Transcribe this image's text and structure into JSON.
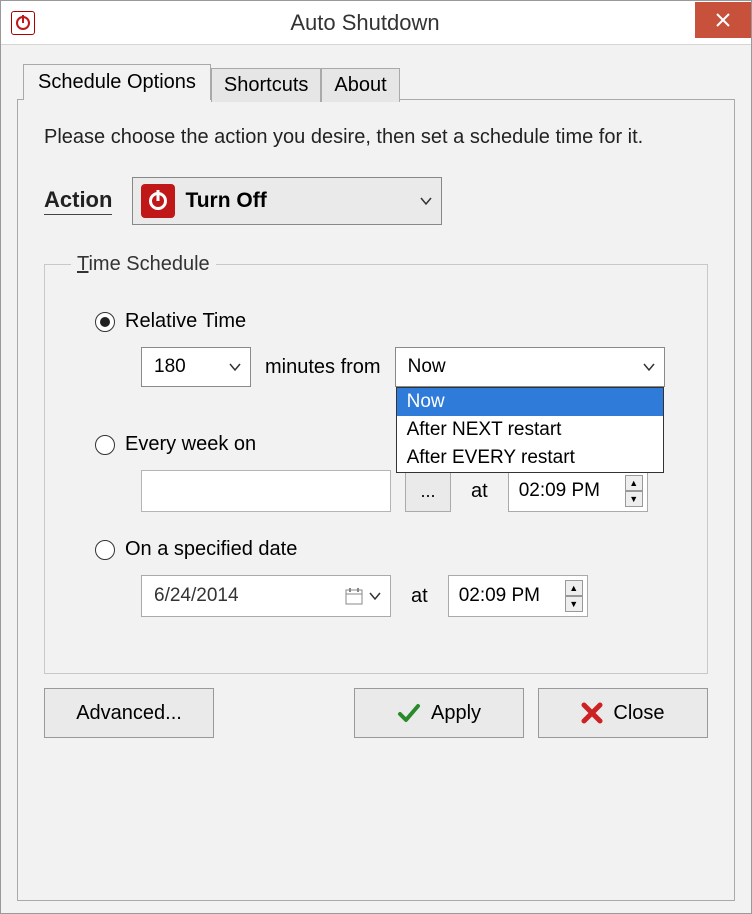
{
  "title": "Auto Shutdown",
  "tabs": [
    {
      "label": "Schedule Options",
      "active": true
    },
    {
      "label": "Shortcuts",
      "active": false
    },
    {
      "label": "About",
      "active": false
    }
  ],
  "intro": "Please choose the action you desire, then set a schedule time for it.",
  "action": {
    "label": "Action",
    "value": "Turn Off"
  },
  "time_schedule": {
    "legend_prefix": "T",
    "legend_rest": "ime Schedule",
    "relative": {
      "label": "Relative Time",
      "checked": true,
      "minutes_value": "180",
      "minutes_from_label": "minutes from",
      "from_selected": "Now",
      "from_options": [
        "Now",
        "After NEXT restart",
        "After EVERY restart"
      ],
      "from_highlight": "Now"
    },
    "weekly": {
      "label": "Every week on",
      "checked": false,
      "day_value": "",
      "browse_label": "...",
      "at_label": "at",
      "time_value": "02:09 PM"
    },
    "specific": {
      "label": "On a specified date",
      "checked": false,
      "date_value": "6/24/2014",
      "at_label": "at",
      "time_value": "02:09 PM"
    }
  },
  "buttons": {
    "advanced": "Advanced...",
    "apply": "Apply",
    "close": "Close"
  }
}
